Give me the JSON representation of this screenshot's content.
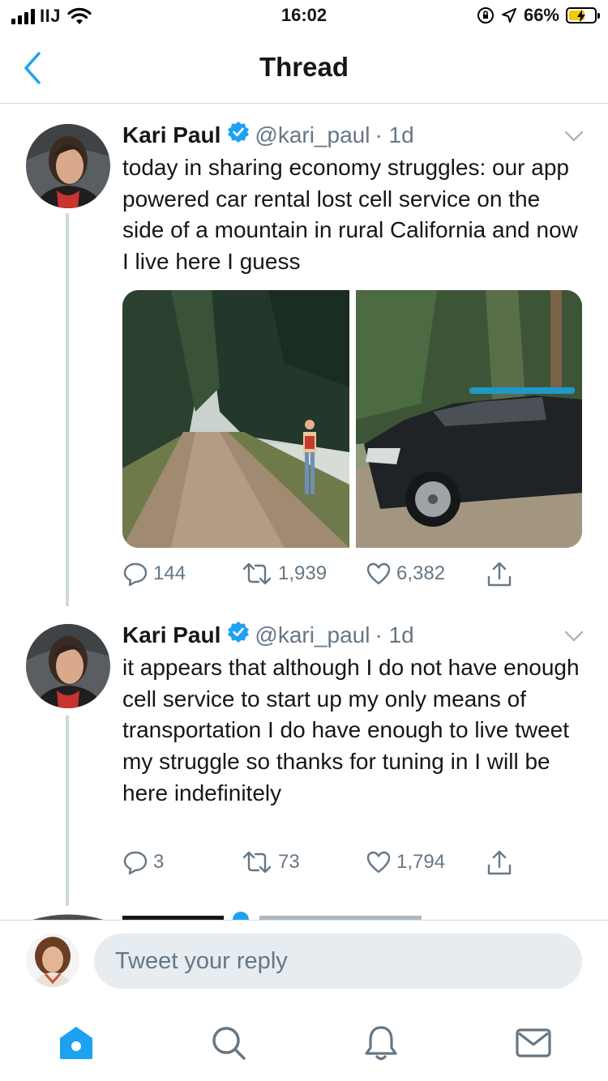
{
  "status_bar": {
    "carrier": "IIJ",
    "time": "16:02",
    "battery": "66%"
  },
  "nav": {
    "title": "Thread"
  },
  "tweets": [
    {
      "name": "Kari Paul",
      "handle": "@kari_paul",
      "age": "· 1d",
      "text": "today in sharing economy struggles: our app powered car rental lost cell service on the side of a mountain in rural California and now I live here I guess",
      "replies": "144",
      "retweets": "1,939",
      "likes": "6,382"
    },
    {
      "name": "Kari Paul",
      "handle": "@kari_paul",
      "age": "· 1d",
      "text": "it appears that although I do not have enough cell service to start up my only means of transportation I do have enough to live tweet my struggle so thanks for tuning in I will be here indefinitely",
      "replies": "3",
      "retweets": "73",
      "likes": "1,794"
    }
  ],
  "reply": {
    "placeholder": "Tweet your reply"
  },
  "tab_bar": {
    "items": [
      "home-icon",
      "search-icon",
      "bell-icon",
      "mail-icon"
    ],
    "active": "home-icon"
  },
  "colors": {
    "accent": "#1da1f2",
    "secondary_text": "#657786",
    "divider": "#d8dde1"
  }
}
